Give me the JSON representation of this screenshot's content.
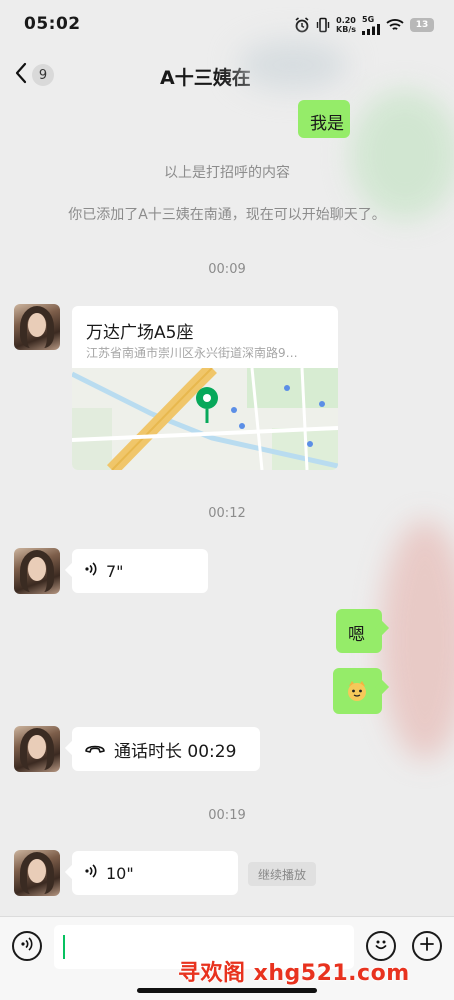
{
  "status_bar": {
    "time": "05:02",
    "net_speed_value": "0.20",
    "net_speed_unit": "KB/s",
    "network": "5G",
    "battery": "13",
    "icons": [
      "alarm-icon",
      "vibrate-icon",
      "signal-icon",
      "wifi-icon",
      "battery-icon"
    ]
  },
  "nav": {
    "back_icon": "chevron-left-icon",
    "unread_count": "9",
    "title": "A十三姨在"
  },
  "chat": {
    "top_message": "我是",
    "system_msg_1": "以上是打招呼的内容",
    "system_msg_2": "你已添加了A十三姨在南通，现在可以开始聊天了。",
    "times": [
      "00:09",
      "00:12",
      "00:19"
    ],
    "location": {
      "title": "万达广场A5座",
      "address": "江苏省南通市崇川区永兴街道深南路9…"
    },
    "voice_1": "7\"",
    "reply_text": "嗯",
    "reply_sticker": "cat-emoji-icon",
    "call": "通话时长 00:29",
    "voice_2": "10\"",
    "resume_label": "继续播放"
  },
  "input": {
    "voice_icon": "voice-mode-icon",
    "emoji_icon": "emoji-icon",
    "plus_icon": "plus-icon",
    "value": ""
  },
  "watermark": "寻欢阁 xhg521.com",
  "colors": {
    "background": "#ededed",
    "bubble_self": "#95ec69",
    "bubble_other": "#ffffff",
    "accent": "#07c160",
    "watermark": "#e8321e"
  }
}
